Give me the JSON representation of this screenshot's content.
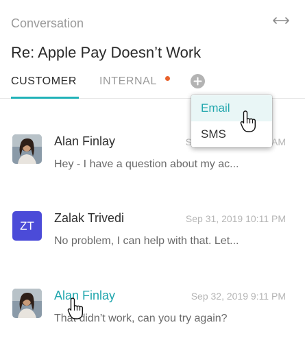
{
  "header": {
    "label": "Conversation",
    "title": "Re: Apple Pay Doesn’t Work",
    "expand_icon": "expand-arrows-icon"
  },
  "tabs": [
    {
      "label": "CUSTOMER",
      "active": true
    },
    {
      "label": "INTERNAL",
      "active": false,
      "has_notification": true
    }
  ],
  "add_button_icon": "plus-icon",
  "dropdown": {
    "items": [
      {
        "label": "Email",
        "highlighted": true
      },
      {
        "label": "SMS",
        "highlighted": false
      }
    ]
  },
  "conversations": [
    {
      "name": "Alan Finlay",
      "time": "Sep 30, 2019 10:10 AM",
      "preview": "Hey - I have a question about my ac...",
      "avatar": "photo"
    },
    {
      "name": "Zalak Trivedi",
      "time": "Sep 31, 2019 10:11 PM",
      "preview": "No problem, I can help with that. Let...",
      "avatar_initials": "ZT"
    },
    {
      "name": "Alan Finlay",
      "time": "Sep 32, 2019 9:11 PM",
      "preview": "That didn’t work, can you try again?",
      "avatar": "photo"
    }
  ],
  "colors": {
    "accent": "#20b2b8",
    "notification": "#e8622c",
    "avatar_zt": "#4b4bd8"
  }
}
